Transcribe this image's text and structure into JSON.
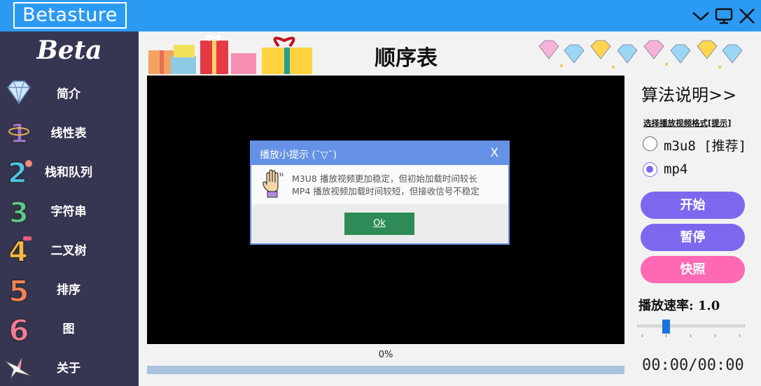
{
  "app": {
    "brand": "Betasture"
  },
  "sidebar": {
    "logo": "Beta",
    "items": [
      {
        "label": "简介",
        "icon": "diamond-icon"
      },
      {
        "label": "线性表",
        "icon": "number-1-icon"
      },
      {
        "label": "栈和队列",
        "icon": "number-2-icon"
      },
      {
        "label": "字符串",
        "icon": "number-3-icon"
      },
      {
        "label": "二叉树",
        "icon": "number-4-icon"
      },
      {
        "label": "排序",
        "icon": "number-5-icon"
      },
      {
        "label": "图",
        "icon": "number-6-icon"
      },
      {
        "label": "关于",
        "icon": "origami-bird-icon"
      }
    ]
  },
  "main": {
    "title": "顺序表"
  },
  "player": {
    "progress_text": "0%",
    "progress": 0
  },
  "dialog": {
    "title": "播放小提示 (¯▽¯)",
    "close": "X",
    "line1": "M3U8 播放视频更加稳定，但初始加载时间较长",
    "line2": "MP4 播放视频加载时间较短，但接收信号不稳定",
    "ok": "Ok"
  },
  "panel": {
    "algo_link": "算法说明>>",
    "format_label": "选择播放视频格式[提示]",
    "formats": [
      {
        "label": "m3u8 [推荐]",
        "selected": false
      },
      {
        "label": "mp4",
        "selected": true
      }
    ],
    "start": "开始",
    "pause": "暂停",
    "snapshot": "快照",
    "speed_label": "播放速率: 1.0",
    "speed_value": 1.0,
    "time": "00:00/00:00"
  },
  "colors": {
    "titlebar": "#2b9af3",
    "sidebar": "#363653",
    "start_button": "#7b68ee",
    "pause_button": "#7b68ee",
    "snapshot_button": "#ff69b4",
    "dialog_accent": "#6592e6",
    "ok_button": "#2e8b57"
  }
}
